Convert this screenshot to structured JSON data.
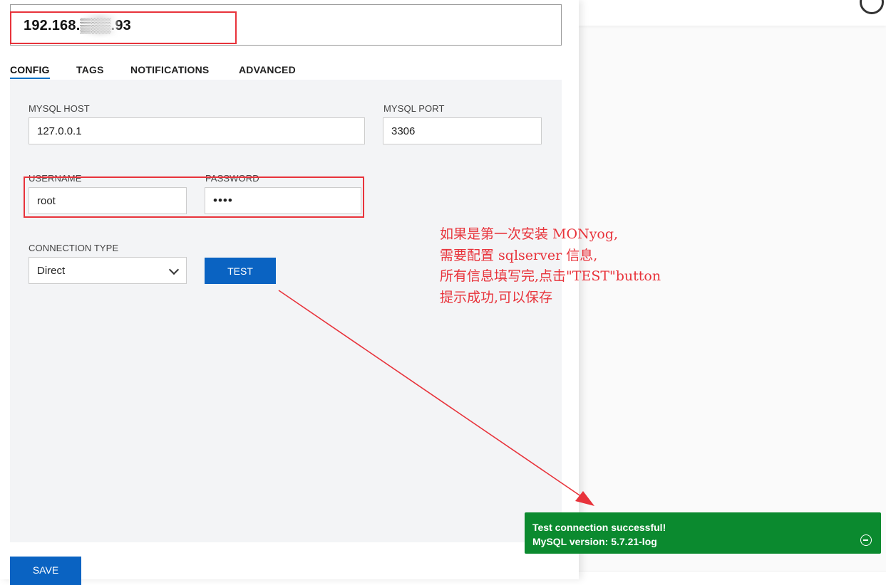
{
  "server": {
    "name": "192.168.▒▒▒.93"
  },
  "tabs": [
    {
      "label": "CONFIG",
      "active": true
    },
    {
      "label": "TAGS"
    },
    {
      "label": "NOTIFICATIONS"
    },
    {
      "label": "ADVANCED"
    }
  ],
  "config": {
    "host_label": "MYSQL HOST",
    "host_value": "127.0.0.1",
    "port_label": "MYSQL PORT",
    "port_value": "3306",
    "username_label": "USERNAME",
    "username_value": "root",
    "password_label": "PASSWORD",
    "password_value": "••••",
    "conn_type_label": "CONNECTION TYPE",
    "conn_type_value": "Direct",
    "test_label": "TEST",
    "save_label": "SAVE"
  },
  "annotation": {
    "lines": [
      "如果是第一次安装 MONyog,",
      "需要配置 sqlserver 信息,",
      "所有信息填写完,点击\"TEST\"button",
      "提示成功,可以保存"
    ],
    "color": "#e8333b"
  },
  "toast": {
    "line1": "Test connection successful!",
    "line2": "MySQL version: 5.7.21-log",
    "color": "#0b8a2f"
  },
  "colors": {
    "accent": "#0a63c2",
    "panel": "#f3f4f6",
    "highlight_box": "#e8333b"
  },
  "icons": [
    "chevron-down-icon",
    "minus-circle-icon",
    "settings-icon"
  ]
}
